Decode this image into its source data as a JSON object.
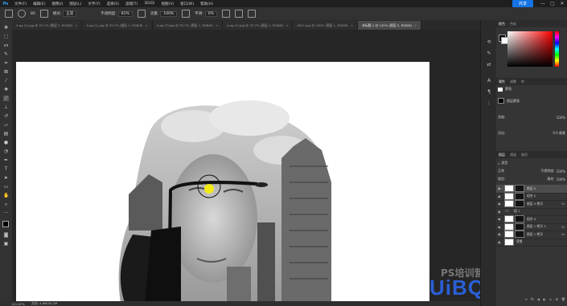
{
  "menubar": {
    "logo": "Ps",
    "items": [
      "文件(F)",
      "编辑(E)",
      "图像(I)",
      "图层(L)",
      "文字(Y)",
      "选择(S)",
      "滤镜(T)",
      "3D(D)",
      "视图(V)",
      "窗口(W)",
      "帮助(H)"
    ],
    "share_label": "共享",
    "win_min": "—",
    "win_max": "▢",
    "win_close": "✕"
  },
  "options": {
    "mode_label": "模式:",
    "mode_value": "正常",
    "opacity_label": "不透明度:",
    "opacity_value": "81%",
    "flow_label": "流量:",
    "flow_value": "100%",
    "smooth_label": "平滑:",
    "smooth_value": "0%",
    "size_value": "80"
  },
  "tabs": [
    {
      "label": "4-ag (2).jpg @ 33.7% (图层 2, RGB/8)",
      "active": false
    },
    {
      "label": "4-ag (1).jpg @ 33.7% (图层 1, RGB/8)",
      "active": false
    },
    {
      "label": "4-ag (3).jpg @ 33.7% (图层 1, RGB/8)",
      "active": false
    },
    {
      "label": "4-ag (1).jpg @ 33.7% (图层 1, RGB/8)",
      "active": false
    },
    {
      "label": "4611.jpg @ 100% (图层 1, RGB/8)",
      "active": false
    },
    {
      "label": "未标题-1 @ 142% (图层 5, RGB/8)",
      "active": true
    }
  ],
  "status": {
    "zoom": "141.67%",
    "doc": "文档: 4.9M/20.2M"
  },
  "colorpanel": {
    "tabs": [
      "颜色",
      "色板"
    ],
    "fg": "#000000",
    "bg": "#ffffff"
  },
  "properties": {
    "tabs": [
      "属性",
      "调整",
      "库"
    ],
    "title": "蒙版",
    "layer_mask": "图层蒙版",
    "density_label": "浓度:",
    "density_value": "100%",
    "feather_label": "羽化:",
    "feather_value": "0.0 像素"
  },
  "layers": {
    "tabs": [
      "图层",
      "通道",
      "路径"
    ],
    "filter_label": "类型",
    "blend_mode": "正常",
    "opacity_label": "不透明度:",
    "opacity_value": "100%",
    "lock_label": "锁定:",
    "fill_label": "填充:",
    "fill_value": "100%",
    "rows": [
      {
        "name": "图层 5",
        "kind": "mask",
        "selected": true,
        "fx": ""
      },
      {
        "name": "组合 2",
        "kind": "mask",
        "selected": false,
        "fx": ""
      },
      {
        "name": "图层 3 拷贝",
        "kind": "mask",
        "selected": false,
        "fx": "fx"
      },
      {
        "name": "组 1",
        "kind": "folder",
        "selected": false,
        "fx": ""
      },
      {
        "name": "组合 4",
        "kind": "mask",
        "selected": false,
        "fx": ""
      },
      {
        "name": "图层 1 拷贝 3",
        "kind": "mask",
        "selected": false,
        "fx": "fx"
      },
      {
        "name": "图层 1 拷贝",
        "kind": "mask",
        "selected": false,
        "fx": "fx"
      },
      {
        "name": "背景",
        "kind": "plain",
        "selected": false,
        "fx": ""
      }
    ],
    "footer_icons": [
      "link-icon",
      "fx-icon",
      "mask-icon",
      "adjust-icon",
      "folder-icon",
      "new-layer-icon",
      "trash-icon"
    ]
  },
  "watermark": {
    "brand": "PS培训营",
    "site": "UiBQ.CoM"
  }
}
